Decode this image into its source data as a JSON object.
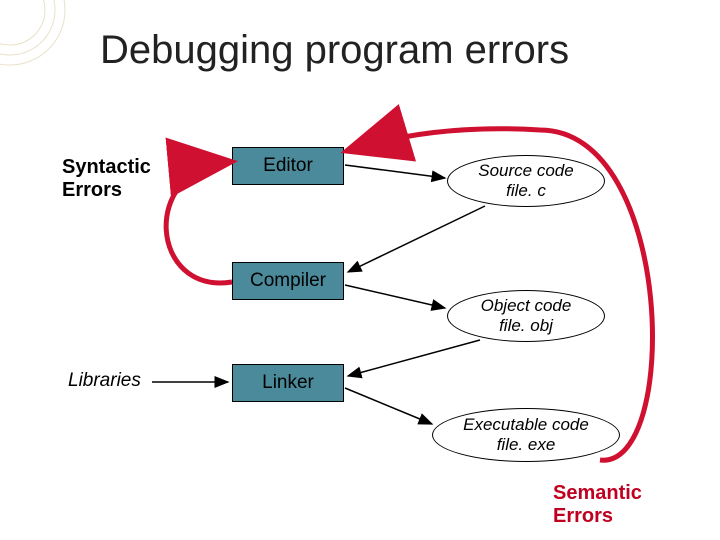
{
  "title": "Debugging program errors",
  "labels": {
    "syntactic": "Syntactic\nErrors",
    "semantic": "Semantic\nErrors",
    "libraries": "Libraries"
  },
  "boxes": {
    "editor": "Editor",
    "compiler": "Compiler",
    "linker": "Linker"
  },
  "ovals": {
    "source": {
      "line1": "Source code",
      "line2": "file. c"
    },
    "object": {
      "line1": "Object code",
      "line2": "file. obj"
    },
    "executable": {
      "line1": "Executable code",
      "line2": "file. exe"
    }
  }
}
